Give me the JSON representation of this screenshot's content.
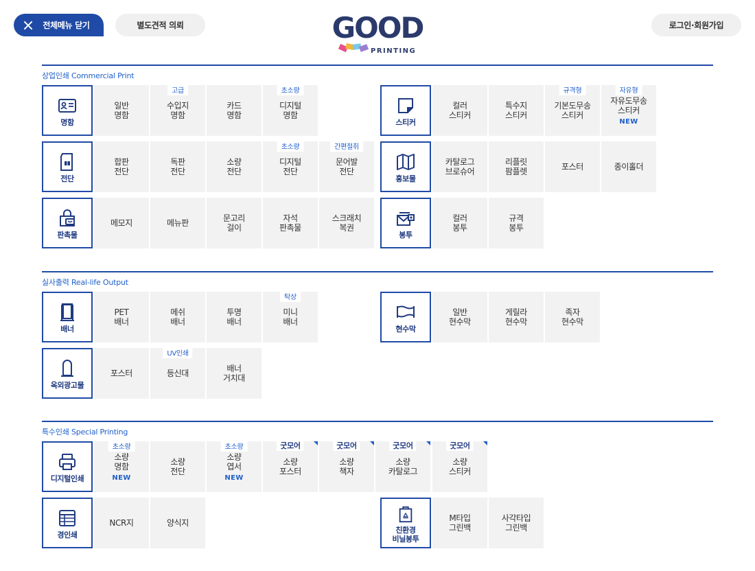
{
  "header": {
    "close_label": "전체메뉴 닫기",
    "quote_label": "별도견적 의뢰",
    "login_label": "로그인·회원가입",
    "logo_word": "GOOD",
    "logo_sub": "PRINTING"
  },
  "sections": {
    "commercial": "상업인쇄 Commercial Print",
    "reallife": "실사출력 Real-life Output",
    "special": "특수인쇄 Special Printing"
  },
  "categories": {
    "business_card": "명함",
    "flyer": "전단",
    "promo": "판촉물",
    "sticker": "스티커",
    "pr": "홍보물",
    "envelope": "봉투",
    "banner": "배너",
    "outdoor": "옥외광고물",
    "placard": "현수막",
    "digital": "디지털인쇄",
    "light": "경인쇄",
    "eco": "친환경\n비닐봉투"
  },
  "items": {
    "bc1": "일반\n명함",
    "bc2": "수입지\n명함",
    "bc3": "카드\n명함",
    "bc4": "디지털\n명함",
    "st1": "컬러\n스티커",
    "st2": "특수지\n스티커",
    "st3": "기본도무송\n스티커",
    "st4": "자유도무송\n스티커",
    "fl1": "합판\n전단",
    "fl2": "독판\n전단",
    "fl3": "소량\n전단",
    "fl4": "디지털\n전단",
    "fl5": "문어발\n전단",
    "pr1": "카탈로그\n브로슈어",
    "pr2": "리플릿\n팜플렛",
    "pr3": "포스터",
    "pr4": "종이홀더",
    "pm1": "메모지",
    "pm2": "메뉴판",
    "pm3": "문고리\n걸이",
    "pm4": "자석\n판촉물",
    "pm5": "스크래치\n복권",
    "ev1": "컬러\n봉투",
    "ev2": "규격\n봉투",
    "bn1": "PET\n배너",
    "bn2": "메쉬\n배너",
    "bn3": "투명\n배너",
    "bn4": "미니\n배너",
    "pc1": "일반\n현수막",
    "pc2": "게릴라\n현수막",
    "pc3": "족자\n현수막",
    "od1": "포스터",
    "od2": "등신대",
    "od3": "배너\n거치대",
    "dg1": "소량\n명함",
    "dg2": "소량\n전단",
    "dg3": "소량\n엽서",
    "dg4": "소량\n포스터",
    "dg5": "소량\n책자",
    "dg6": "소량\n카탈로그",
    "dg7": "소량\n스티커",
    "li1": "NCR지",
    "li2": "양식지",
    "ec1": "M타입\n그린백",
    "ec2": "사각타입\n그린백"
  },
  "tags": {
    "premium": "고급",
    "small_qty": "초소량",
    "basic_shape": "규격형",
    "free_shape": "자유형",
    "simple_fold": "간편절취",
    "desktop": "탁상",
    "uv": "UV인쇄",
    "brand": "굿모어"
  },
  "new_label": "NEW",
  "colors": {
    "primary": "#1f4aa6",
    "accent": "#1f5fc9",
    "cell_bg": "#f2f2f2"
  }
}
